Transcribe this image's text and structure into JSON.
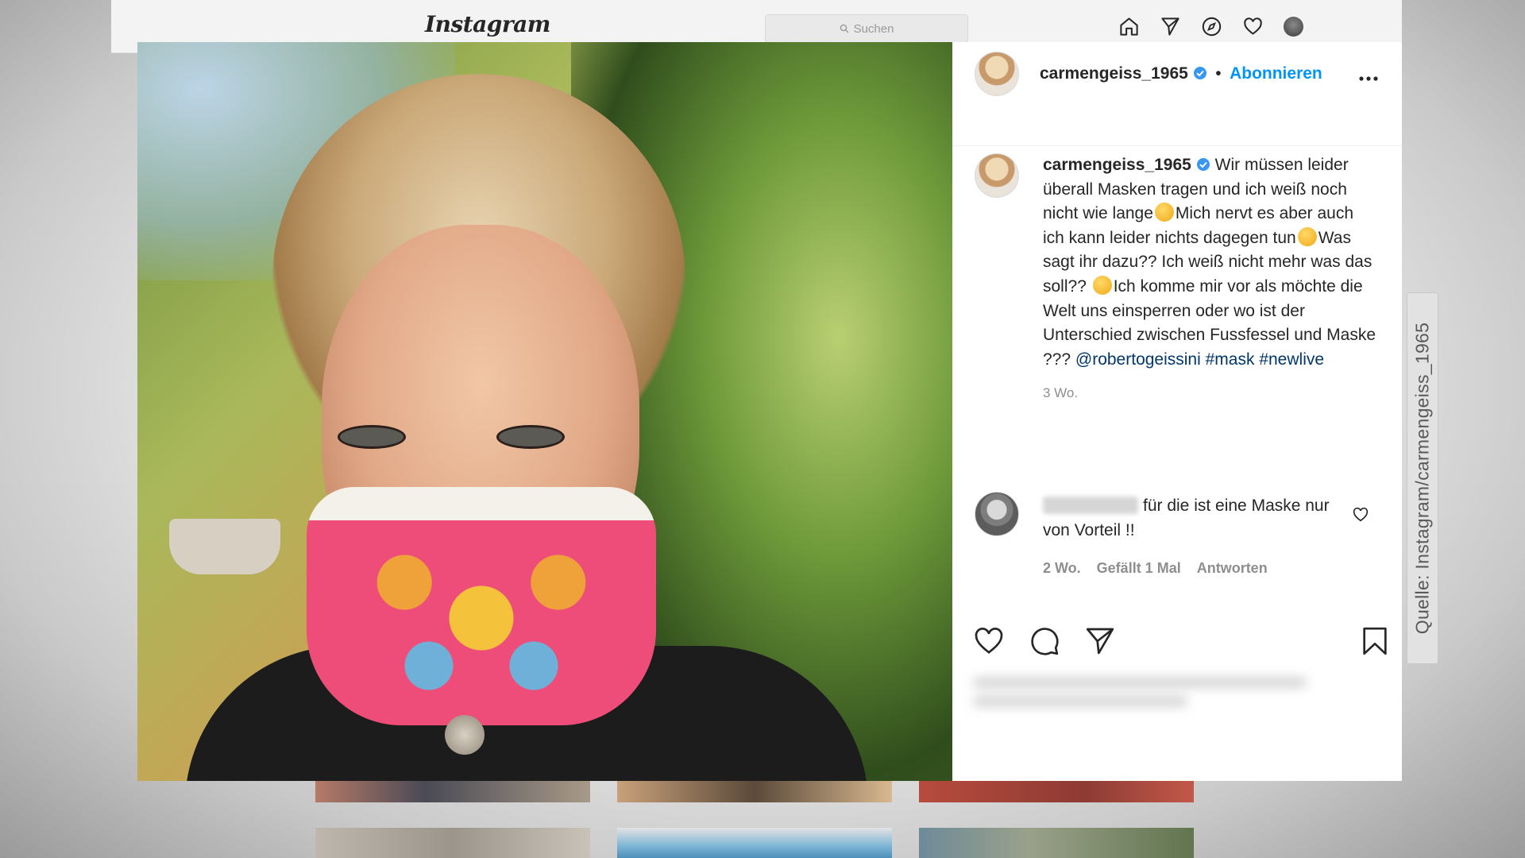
{
  "topbar": {
    "logo": "Instagram",
    "search_placeholder": "Suchen",
    "icons": [
      "home-icon",
      "direct-icon",
      "explore-icon",
      "activity-heart-icon",
      "profile-avatar"
    ]
  },
  "post": {
    "username": "carmengeiss_1965",
    "separator": "•",
    "follow_label": "Abonnieren",
    "caption": {
      "username": "carmengeiss_1965",
      "part1": "Wir müssen leider überall Masken tragen und ich weiß noch nicht wie lange",
      "part2": "Mich nervt es aber auch ich kann leider nichts dagegen tun",
      "part3": "Was sagt ihr dazu?? Ich weiß nicht mehr was das soll??",
      "part4": "Ich komme mir vor als möchte die Welt uns einsperren oder wo ist der Unterschied zwischen Fussfessel und Maske ???",
      "mention": "@robertogeissini",
      "hashtag1": "#mask",
      "hashtag2": "#newlive",
      "time": "3 Wo."
    },
    "comment": {
      "text": "für die ist eine Maske nur von Vorteil !!",
      "time": "2 Wo.",
      "likes": "Gefällt 1 Mal",
      "reply": "Antworten"
    }
  },
  "credit": "Quelle: Instagram/carmengeiss_1965",
  "colors": {
    "accent": "#0095f6",
    "link": "#00376b",
    "muted": "#8e8e8e",
    "text": "#262626"
  }
}
